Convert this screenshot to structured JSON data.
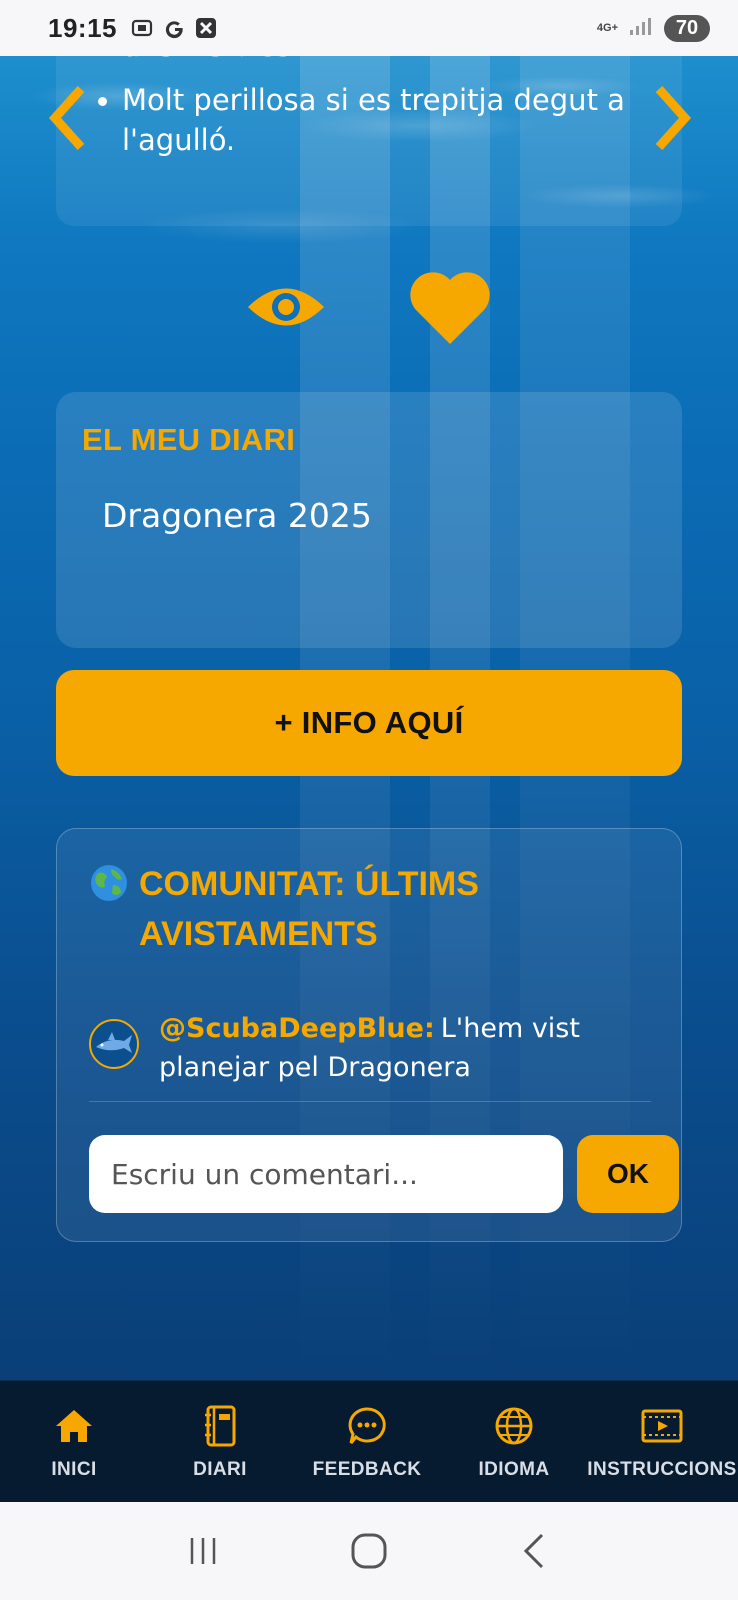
{
  "status_bar": {
    "time": "19:15",
    "network": "4G+",
    "battery": "70"
  },
  "species_card": {
    "cut_text": "uns visibles.",
    "bullets": [
      "Molt perillosa si es trepitja degut a l'agulló."
    ]
  },
  "diary": {
    "title": "EL MEU DIARI",
    "entries": [
      "Dragonera 2025"
    ]
  },
  "info_button": {
    "label": "+ INFO AQUÍ"
  },
  "community": {
    "title": "COMUNITAT: ÚLTIMS AVISTAMENTS",
    "comments": [
      {
        "user": "@ScubaDeepBlue:",
        "text": "L'hem vist planejar pel Dragonera"
      }
    ],
    "input_placeholder": "Escriu un comentari...",
    "submit_label": "OK"
  },
  "bottom_nav": {
    "items": [
      {
        "label": "INICI",
        "icon": "home-icon",
        "active": true
      },
      {
        "label": "DIARI",
        "icon": "notebook-icon"
      },
      {
        "label": "FEEDBACK",
        "icon": "chat-bubble-icon"
      },
      {
        "label": "IDIOMA",
        "icon": "globe-icon"
      },
      {
        "label": "INSTRUCCIONS",
        "icon": "video-icon"
      }
    ]
  },
  "colors": {
    "accent": "#f7a800",
    "nav_background": "#061a30",
    "ocean": "#0b6cb5"
  }
}
